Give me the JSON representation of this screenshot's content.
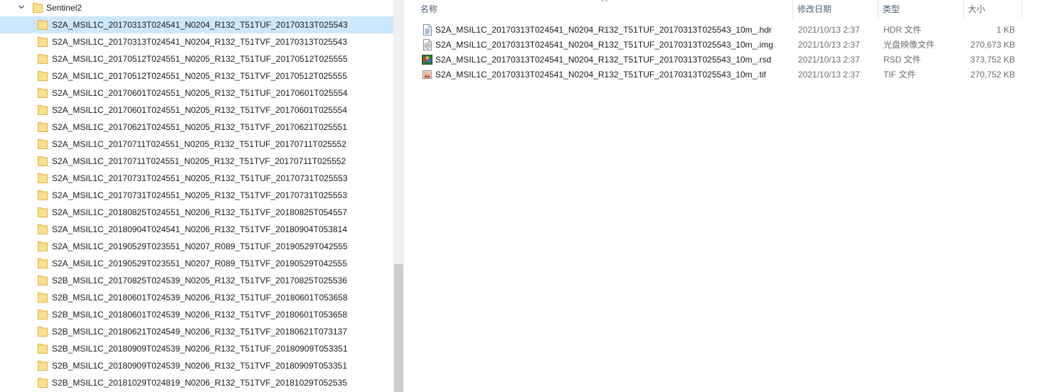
{
  "colors": {
    "selection": "#cce8ff",
    "folder": "#f8d775",
    "header_text": "#4c607a",
    "secondary_text": "#6d6d6d"
  },
  "nav": {
    "parent": {
      "label": "Sentinel2",
      "expanded": true,
      "icon": "folder-icon"
    },
    "selected_index": 0,
    "items": [
      {
        "label": "S2A_MSIL1C_20170313T024541_N0204_R132_T51TUF_20170313T025543"
      },
      {
        "label": "S2A_MSIL1C_20170313T024541_N0204_R132_T51TVF_20170313T025543"
      },
      {
        "label": "S2A_MSIL1C_20170512T024551_N0205_R132_T51TUF_20170512T025555"
      },
      {
        "label": "S2A_MSIL1C_20170512T024551_N0205_R132_T51TVF_20170512T025555"
      },
      {
        "label": "S2A_MSIL1C_20170601T024551_N0205_R132_T51TUF_20170601T025554"
      },
      {
        "label": "S2A_MSIL1C_20170601T024551_N0205_R132_T51TVF_20170601T025554"
      },
      {
        "label": "S2A_MSIL1C_20170621T024551_N0205_R132_T51TVF_20170621T025551"
      },
      {
        "label": "S2A_MSIL1C_20170711T024551_N0205_R132_T51TUF_20170711T025552"
      },
      {
        "label": "S2A_MSIL1C_20170711T024551_N0205_R132_T51TVF_20170711T025552"
      },
      {
        "label": "S2A_MSIL1C_20170731T024551_N0205_R132_T51TUF_20170731T025553"
      },
      {
        "label": "S2A_MSIL1C_20170731T024551_N0205_R132_T51TVF_20170731T025553"
      },
      {
        "label": "S2A_MSIL1C_20180825T024551_N0206_R132_T51TVF_20180825T054557"
      },
      {
        "label": "S2A_MSIL1C_20180904T024541_N0206_R132_T51TVF_20180904T053814"
      },
      {
        "label": "S2A_MSIL1C_20190529T023551_N0207_R089_T51TUF_20190529T042555"
      },
      {
        "label": "S2A_MSIL1C_20190529T023551_N0207_R089_T51TVF_20190529T042555"
      },
      {
        "label": "S2B_MSIL1C_20170825T024539_N0205_R132_T51TVF_20170825T025536"
      },
      {
        "label": "S2B_MSIL1C_20180601T024539_N0206_R132_T51TUF_20180601T053658"
      },
      {
        "label": "S2B_MSIL1C_20180601T024539_N0206_R132_T51TVF_20180601T053658"
      },
      {
        "label": "S2B_MSIL1C_20180621T024549_N0206_R132_T51TVF_20180621T073137"
      },
      {
        "label": "S2B_MSIL1C_20180909T024539_N0206_R132_T51TUF_20180909T053351"
      },
      {
        "label": "S2B_MSIL1C_20180909T024539_N0206_R132_T51TVF_20180909T053351"
      },
      {
        "label": "S2B_MSIL1C_20181029T024819_N0206_R132_T51TVF_20181029T052535"
      }
    ]
  },
  "columns": {
    "name": "名称",
    "date": "修改日期",
    "type": "类型",
    "size": "大小"
  },
  "files": [
    {
      "name": "S2A_MSIL1C_20170313T024541_N0204_R132_T51TUF_20170313T025543_10m_.hdr",
      "date": "2021/10/13 2:37",
      "type": "HDR 文件",
      "size": "1 KB",
      "icon": "text-file-icon"
    },
    {
      "name": "S2A_MSIL1C_20170313T024541_N0204_R132_T51TUF_20170313T025543_10m_.img",
      "date": "2021/10/13 2:37",
      "type": "光盘映像文件",
      "size": "270,673 KB",
      "icon": "disc-image-file-icon"
    },
    {
      "name": "S2A_MSIL1C_20170313T024541_N0204_R132_T51TUF_20170313T025543_10m_.rsd",
      "date": "2021/10/13 2:37",
      "type": "RSD 文件",
      "size": "373,752 KB",
      "icon": "rsd-file-icon"
    },
    {
      "name": "S2A_MSIL1C_20170313T024541_N0204_R132_T51TUF_20170313T025543_10m_.tif",
      "date": "2021/10/13 2:37",
      "type": "TIF 文件",
      "size": "270,752 KB",
      "icon": "image-file-icon"
    }
  ]
}
